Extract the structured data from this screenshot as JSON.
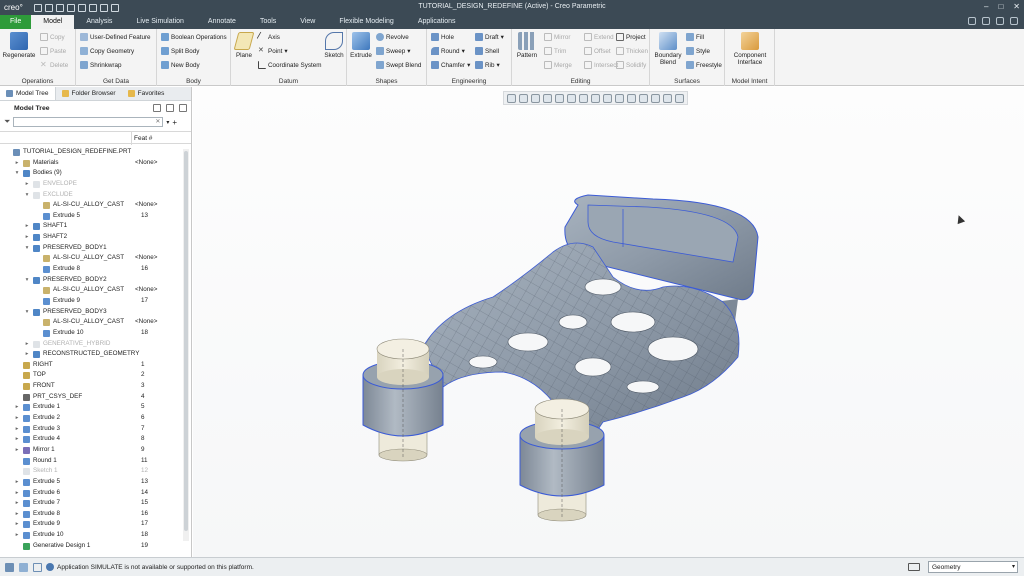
{
  "app": {
    "logo": "creo°",
    "title": "TUTORIAL_DESIGN_REDEFINE (Active) - Creo Parametric"
  },
  "menu": {
    "items": [
      "File",
      "Model",
      "Analysis",
      "Live Simulation",
      "Annotate",
      "Tools",
      "View",
      "Flexible Modeling",
      "Applications"
    ]
  },
  "ribbon": {
    "operations": {
      "regenerate": "Regenerate",
      "copy": "Copy",
      "paste": "Paste",
      "delete": "Delete",
      "label": "Operations"
    },
    "get_data": {
      "udf": "User-Defined Feature",
      "copy_geometry": "Copy Geometry",
      "shrinkwrap": "Shrinkwrap",
      "label": "Get Data"
    },
    "body": {
      "boolean": "Boolean Operations",
      "split": "Split Body",
      "new": "New Body",
      "label": "Body"
    },
    "datum": {
      "plane": "Plane",
      "axis": "Axis",
      "point": "Point",
      "csys": "Coordinate System",
      "sketch": "Sketch",
      "label": "Datum"
    },
    "shapes": {
      "extrude": "Extrude",
      "revolve": "Revolve",
      "sweep": "Sweep",
      "swept_blend": "Swept Blend",
      "label": "Shapes"
    },
    "engineering": {
      "hole": "Hole",
      "round": "Round",
      "chamfer": "Chamfer",
      "draft": "Draft",
      "shell": "Shell",
      "rib": "Rib",
      "label": "Engineering"
    },
    "editing": {
      "pattern": "Pattern",
      "mirror": "Mirror",
      "trim": "Trim",
      "merge": "Merge",
      "extend": "Extend",
      "offset": "Offset",
      "intersect": "Intersect",
      "project": "Project",
      "thicken": "Thicken",
      "solidify": "Solidify",
      "label": "Editing"
    },
    "surfaces": {
      "boundary": "Boundary",
      "blend": "Blend",
      "fill": "Fill",
      "style": "Style",
      "freestyle": "Freestyle",
      "label": "Surfaces"
    },
    "model_intent": {
      "component": "Component",
      "interface": "Interface",
      "label": "Model Intent"
    }
  },
  "panel": {
    "tabs": [
      "Model Tree",
      "Folder Browser",
      "Favorites"
    ],
    "tree_title": "Model Tree",
    "feat_col": "Feat #",
    "rows": [
      {
        "label": "TUTORIAL_DESIGN_REDEFINE.PRT",
        "feat": "",
        "indent": 0,
        "exp": "",
        "icon": "part",
        "dim": false
      },
      {
        "label": "Materials",
        "feat": "<None>",
        "indent": 1,
        "exp": "▸",
        "icon": "material",
        "dim": false
      },
      {
        "label": "Bodies (9)",
        "feat": "",
        "indent": 1,
        "exp": "▾",
        "icon": "bodies",
        "dim": false
      },
      {
        "label": "ENVELOPE",
        "feat": "",
        "indent": 2,
        "exp": "▸",
        "icon": "body",
        "dim": true
      },
      {
        "label": "EXCLUDE",
        "feat": "",
        "indent": 2,
        "exp": "▾",
        "icon": "body",
        "dim": true
      },
      {
        "label": "AL-SI-CU_ALLOY_CAST",
        "feat": "<None>",
        "indent": 3,
        "exp": "",
        "icon": "material",
        "dim": false
      },
      {
        "label": "Extrude 5",
        "feat": "13",
        "indent": 3,
        "exp": "",
        "icon": "extrude",
        "dim": false
      },
      {
        "label": "SHAFT1",
        "feat": "",
        "indent": 2,
        "exp": "▸",
        "icon": "body",
        "dim": false
      },
      {
        "label": "SHAFT2",
        "feat": "",
        "indent": 2,
        "exp": "▸",
        "icon": "body",
        "dim": false
      },
      {
        "label": "PRESERVED_BODY1",
        "feat": "",
        "indent": 2,
        "exp": "▾",
        "icon": "body",
        "dim": false
      },
      {
        "label": "AL-SI-CU_ALLOY_CAST",
        "feat": "<None>",
        "indent": 3,
        "exp": "",
        "icon": "material",
        "dim": false
      },
      {
        "label": "Extrude 8",
        "feat": "16",
        "indent": 3,
        "exp": "",
        "icon": "extrude",
        "dim": false
      },
      {
        "label": "PRESERVED_BODY2",
        "feat": "",
        "indent": 2,
        "exp": "▾",
        "icon": "body",
        "dim": false
      },
      {
        "label": "AL-SI-CU_ALLOY_CAST",
        "feat": "<None>",
        "indent": 3,
        "exp": "",
        "icon": "material",
        "dim": false
      },
      {
        "label": "Extrude 9",
        "feat": "17",
        "indent": 3,
        "exp": "",
        "icon": "extrude",
        "dim": false
      },
      {
        "label": "PRESERVED_BODY3",
        "feat": "",
        "indent": 2,
        "exp": "▾",
        "icon": "body",
        "dim": false
      },
      {
        "label": "AL-SI-CU_ALLOY_CAST",
        "feat": "<None>",
        "indent": 3,
        "exp": "",
        "icon": "material",
        "dim": false
      },
      {
        "label": "Extrude 10",
        "feat": "18",
        "indent": 3,
        "exp": "",
        "icon": "extrude",
        "dim": false
      },
      {
        "label": "GENERATIVE_HYBRID",
        "feat": "",
        "indent": 2,
        "exp": "▸",
        "icon": "body",
        "dim": true
      },
      {
        "label": "RECONSTRUCTED_GEOMETRY",
        "feat": "",
        "indent": 2,
        "exp": "▸",
        "icon": "body",
        "dim": false
      },
      {
        "label": "RIGHT",
        "feat": "1",
        "indent": 1,
        "exp": "",
        "icon": "plane",
        "dim": false
      },
      {
        "label": "TOP",
        "feat": "2",
        "indent": 1,
        "exp": "",
        "icon": "plane",
        "dim": false
      },
      {
        "label": "FRONT",
        "feat": "3",
        "indent": 1,
        "exp": "",
        "icon": "plane",
        "dim": false
      },
      {
        "label": "PRT_CSYS_DEF",
        "feat": "4",
        "indent": 1,
        "exp": "",
        "icon": "csys",
        "dim": false
      },
      {
        "label": "Extrude 1",
        "feat": "5",
        "indent": 1,
        "exp": "▸",
        "icon": "extrude",
        "dim": false
      },
      {
        "label": "Extrude 2",
        "feat": "6",
        "indent": 1,
        "exp": "▸",
        "icon": "extrude",
        "dim": false
      },
      {
        "label": "Extrude 3",
        "feat": "7",
        "indent": 1,
        "exp": "▸",
        "icon": "extrude",
        "dim": false
      },
      {
        "label": "Extrude 4",
        "feat": "8",
        "indent": 1,
        "exp": "▸",
        "icon": "extrude",
        "dim": false
      },
      {
        "label": "Mirror 1",
        "feat": "9",
        "indent": 1,
        "exp": "▸",
        "icon": "mirror",
        "dim": false
      },
      {
        "label": "Round 1",
        "feat": "11",
        "indent": 1,
        "exp": "",
        "icon": "round",
        "dim": false
      },
      {
        "label": "Sketch 1",
        "feat": "12",
        "indent": 1,
        "exp": "",
        "icon": "sketch",
        "dim": true
      },
      {
        "label": "Extrude 5",
        "feat": "13",
        "indent": 1,
        "exp": "▸",
        "icon": "extrude",
        "dim": false
      },
      {
        "label": "Extrude 6",
        "feat": "14",
        "indent": 1,
        "exp": "▸",
        "icon": "extrude",
        "dim": false
      },
      {
        "label": "Extrude 7",
        "feat": "15",
        "indent": 1,
        "exp": "▸",
        "icon": "extrude",
        "dim": false
      },
      {
        "label": "Extrude 8",
        "feat": "16",
        "indent": 1,
        "exp": "▸",
        "icon": "extrude",
        "dim": false
      },
      {
        "label": "Extrude 9",
        "feat": "17",
        "indent": 1,
        "exp": "▸",
        "icon": "extrude",
        "dim": false
      },
      {
        "label": "Extrude 10",
        "feat": "18",
        "indent": 1,
        "exp": "▸",
        "icon": "extrude",
        "dim": false
      },
      {
        "label": "Generative Design 1",
        "feat": "19",
        "indent": 1,
        "exp": "",
        "icon": "generative",
        "dim": false
      }
    ]
  },
  "status": {
    "message": "Application SIMULATE is not available or supported on this platform.",
    "filter": "Geometry"
  },
  "colors": {
    "titlebar": "#3c4a55",
    "file_tab": "#2e9b3a",
    "model_body": "#8e9aa8",
    "model_cap": "#eeeadb",
    "edge_highlight": "#3b5bd6"
  }
}
